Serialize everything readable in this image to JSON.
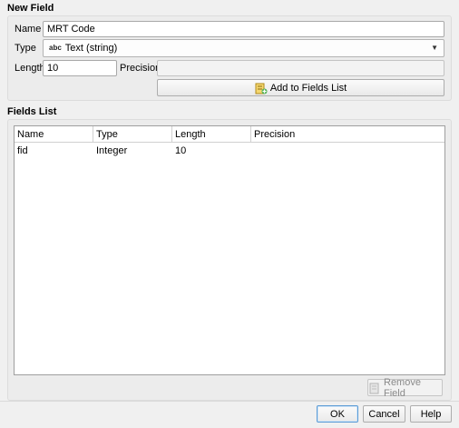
{
  "new_field": {
    "title": "New Field",
    "name_label": "Name",
    "name_value": "MRT Code",
    "type_label": "Type",
    "type_icon": "abc",
    "type_value": "Text (string)",
    "length_label": "Length",
    "length_value": "10",
    "precision_label": "Precision",
    "precision_value": "",
    "add_button": "Add to Fields List"
  },
  "fields_list": {
    "title": "Fields List",
    "columns": [
      "Name",
      "Type",
      "Length",
      "Precision"
    ],
    "rows": [
      [
        "fid",
        "Integer",
        "10",
        ""
      ]
    ],
    "remove_button": "Remove Field"
  },
  "dialog_buttons": {
    "ok": "OK",
    "cancel": "Cancel",
    "help": "Help"
  }
}
